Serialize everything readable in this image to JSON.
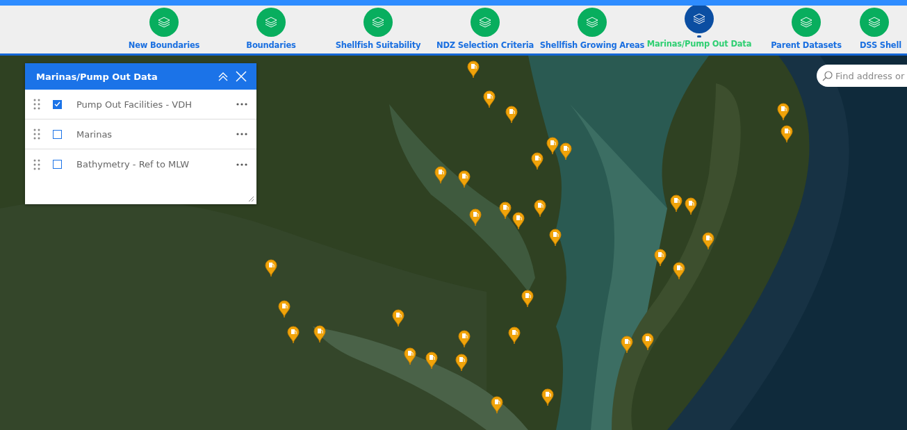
{
  "nav": {
    "items": [
      {
        "label": "New Boundaries",
        "selected": false
      },
      {
        "label": "Boundaries",
        "selected": false
      },
      {
        "label": "Shellfish Suitability",
        "selected": false
      },
      {
        "label": "NDZ Selection Criteria",
        "selected": false
      },
      {
        "label": "Shellfish Growing Areas",
        "selected": false
      },
      {
        "label": "Marinas/Pump Out Data",
        "selected": true
      },
      {
        "label": "Parent Datasets",
        "selected": false
      },
      {
        "label": "DSS Shell",
        "selected": false
      }
    ]
  },
  "layer_panel": {
    "title": "Marinas/Pump Out Data",
    "layers": [
      {
        "name": "Pump Out Facilities - VDH",
        "checked": true
      },
      {
        "name": "Marinas",
        "checked": false
      },
      {
        "name": "Bathymetry - Ref to MLW",
        "checked": false
      }
    ]
  },
  "search": {
    "placeholder": "Find address or"
  }
}
